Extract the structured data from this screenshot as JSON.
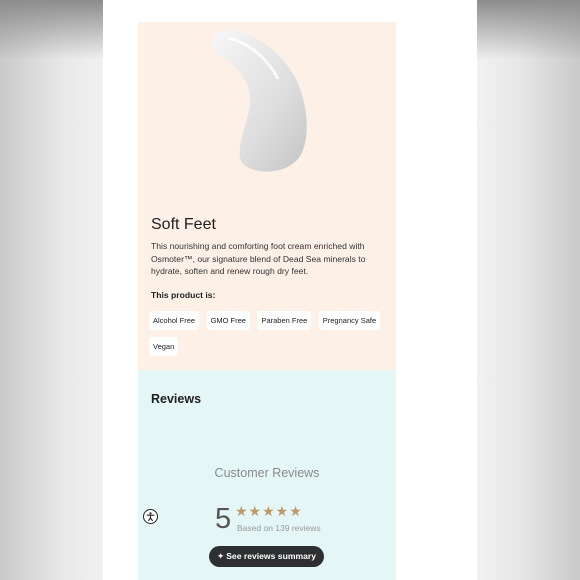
{
  "product": {
    "title": "Soft Feet",
    "description": "This nourishing and comforting foot cream enriched with Osmoter™, our signature blend of Dead Sea minerals to hydrate, soften and renew rough dry feet.",
    "attributes_heading": "This product is:",
    "attributes": [
      "Alcohol Free",
      "GMO Free",
      "Paraben Free",
      "Pregnancy Safe",
      "Vegan"
    ],
    "panel_color": "#fdf0e7",
    "image_icon": "cream-swatch"
  },
  "reviews": {
    "heading": "Reviews",
    "customer_reviews_label": "Customer Reviews",
    "score": "5",
    "stars": "★★★★★",
    "rating_fraction": 1.0,
    "based_on": "Based on 139 reviews",
    "summary_button": "See reviews summary",
    "summary_icon": "sparkle-icon",
    "panel_color": "#e4f6f5",
    "star_color": "#bb9a67"
  },
  "accessibility": {
    "icon": "accessibility-icon"
  }
}
